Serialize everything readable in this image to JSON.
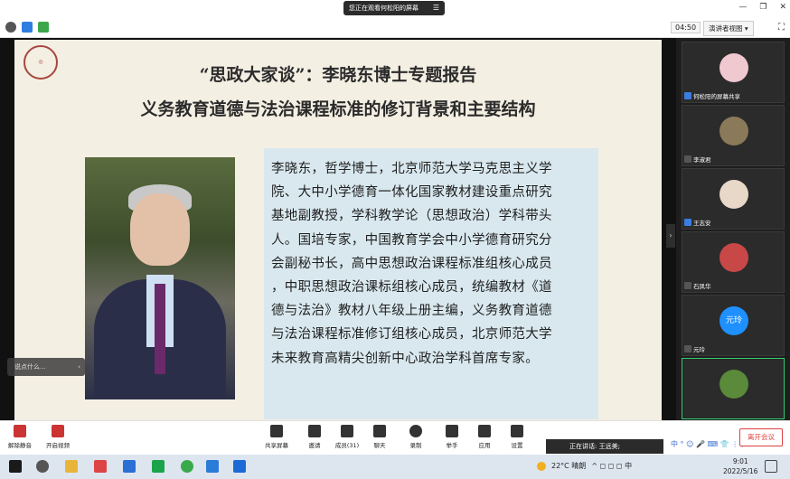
{
  "topbar": {
    "share_notice": "您正在观看何松阳的屏幕",
    "menu_icon": "menu-icon"
  },
  "meeting": {
    "timer": "04:50",
    "speaker_view": "演讲者视图"
  },
  "slide": {
    "title1": "“思政大家谈”：李晓东博士专题报告",
    "title2": "义务教育道德与法治课程标准的修订背景和主要结构",
    "bio_lines": [
      "李晓东，哲学博士，北京师范大学马克思主义学",
      "院、大中小学德育一体化国家教材建设重点研究",
      "基地副教授，学科教学论（思想政治）学科带头",
      "人。国培专家，中国教育学会中小学德育研究分",
      "会副秘书长，高中思想政治课程标准组核心成员",
      "，中职思想政治课标组核心成员，统编教材《道",
      "德与法治》教材八年级上册主编，义务教育道德",
      "与法治课程标准修订组核心成员，北京师范大学",
      "未来教育高精尖创新中心政治学科首席专家。"
    ]
  },
  "chat_pill": {
    "placeholder": "说点什么..."
  },
  "participants": [
    {
      "name": "何松阳的屏幕共享",
      "avatar_color": "#f0c8d0"
    },
    {
      "name": "李淑君",
      "avatar_color": "#8a7a5a"
    },
    {
      "name": "王志安",
      "avatar_color": "#e8d8c8"
    },
    {
      "name": "石凤华",
      "avatar_color": "#c84848"
    },
    {
      "name": "元玲",
      "avatar_color": "#1e90ff",
      "initials": "元玲"
    },
    {
      "name": "",
      "avatar_color": "#5a8a3a"
    }
  ],
  "toolbar": {
    "unmute": "解除静音",
    "video": "开启视频",
    "share": "共享屏幕",
    "invite": "邀请",
    "members": "成员(31)",
    "chat": "聊天",
    "record": "录制",
    "raise_hand": "举手",
    "apps": "应用",
    "settings": "设置",
    "speaking": "正在讲话: 王远美;",
    "leave": "离开会议",
    "ime": "中 ° ☺ 🎤 ⌨ 👕 ⋮⋮"
  },
  "taskbar": {
    "weather": "22°C 晴朗",
    "tray": "^ ◻ ◻ ◻ 中",
    "time": "9:01",
    "date": "2022/5/16"
  },
  "colors": {
    "slide_bg": "#f4efe3",
    "bio_bg": "#d9e8ef",
    "accent_red": "#e04040",
    "panel_bg": "#1e1e1e"
  }
}
